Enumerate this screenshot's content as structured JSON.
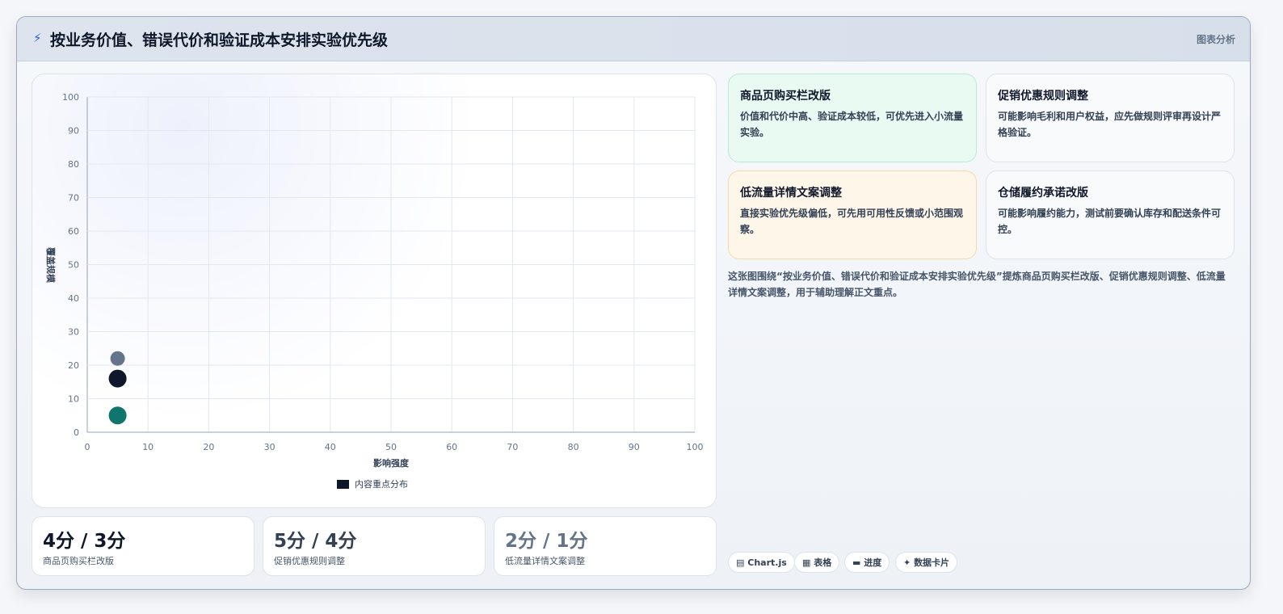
{
  "header": {
    "title": "按业务价值、错误代价和验证成本安排实验优先级",
    "tag": "图表分析"
  },
  "chart_data": {
    "type": "scatter",
    "xlabel": "影响强度",
    "ylabel": "覆盖规模",
    "xlim": [
      0,
      100
    ],
    "ylim": [
      0,
      100
    ],
    "x_ticks": [
      "0",
      "10",
      "20",
      "30",
      "40",
      "50",
      "60",
      "70",
      "80",
      "90",
      "100"
    ],
    "y_ticks": [
      "0",
      "10",
      "20",
      "30",
      "40",
      "50",
      "60",
      "70",
      "80",
      "90",
      "100"
    ],
    "grid": true,
    "legend": {
      "position": "bottom",
      "label": "内容重点分布",
      "color": "#0f172a"
    },
    "points": [
      {
        "x": 5,
        "y": 22,
        "color": "#64748b"
      },
      {
        "x": 5,
        "y": 16,
        "color": "#0f172a"
      },
      {
        "x": 5,
        "y": 5,
        "color": "#0f766e"
      }
    ]
  },
  "metrics": [
    {
      "value": "4分 / 3分",
      "label": "商品页购买栏改版",
      "color": "#0f172a"
    },
    {
      "value": "5分 / 4分",
      "label": "促销优惠规则调整",
      "color": "#334155"
    },
    {
      "value": "2分 / 1分",
      "label": "低流量详情文案调整",
      "color": "#64748b"
    }
  ],
  "cards": [
    {
      "title": "商品页购买栏改版",
      "desc": "价值和代价中高、验证成本较低，可优先进入小流量实验。"
    },
    {
      "title": "促销优惠规则调整",
      "desc": "可能影响毛利和用户权益，应先做规则评审再设计严格验证。"
    },
    {
      "title": "低流量详情文案调整",
      "desc": "直接实验优先级偏低，可先用可用性反馈或小范围观察。"
    },
    {
      "title": "仓储履约承诺改版",
      "desc": "可能影响履约能力，测试前要确认库存和配送条件可控。"
    }
  ],
  "summary": "这张图围绕“按业务价值、错误代价和验证成本安排实验优先级”提炼商品页购买栏改版、促销优惠规则调整、低流量详情文案调整，用于辅助理解正文重点。",
  "pills": [
    {
      "icon": "▤",
      "label": "Chart.js"
    },
    {
      "icon": "▦",
      "label": "表格"
    },
    {
      "icon": "▬",
      "label": "进度"
    },
    {
      "icon": "✦",
      "label": "数据卡片"
    }
  ]
}
